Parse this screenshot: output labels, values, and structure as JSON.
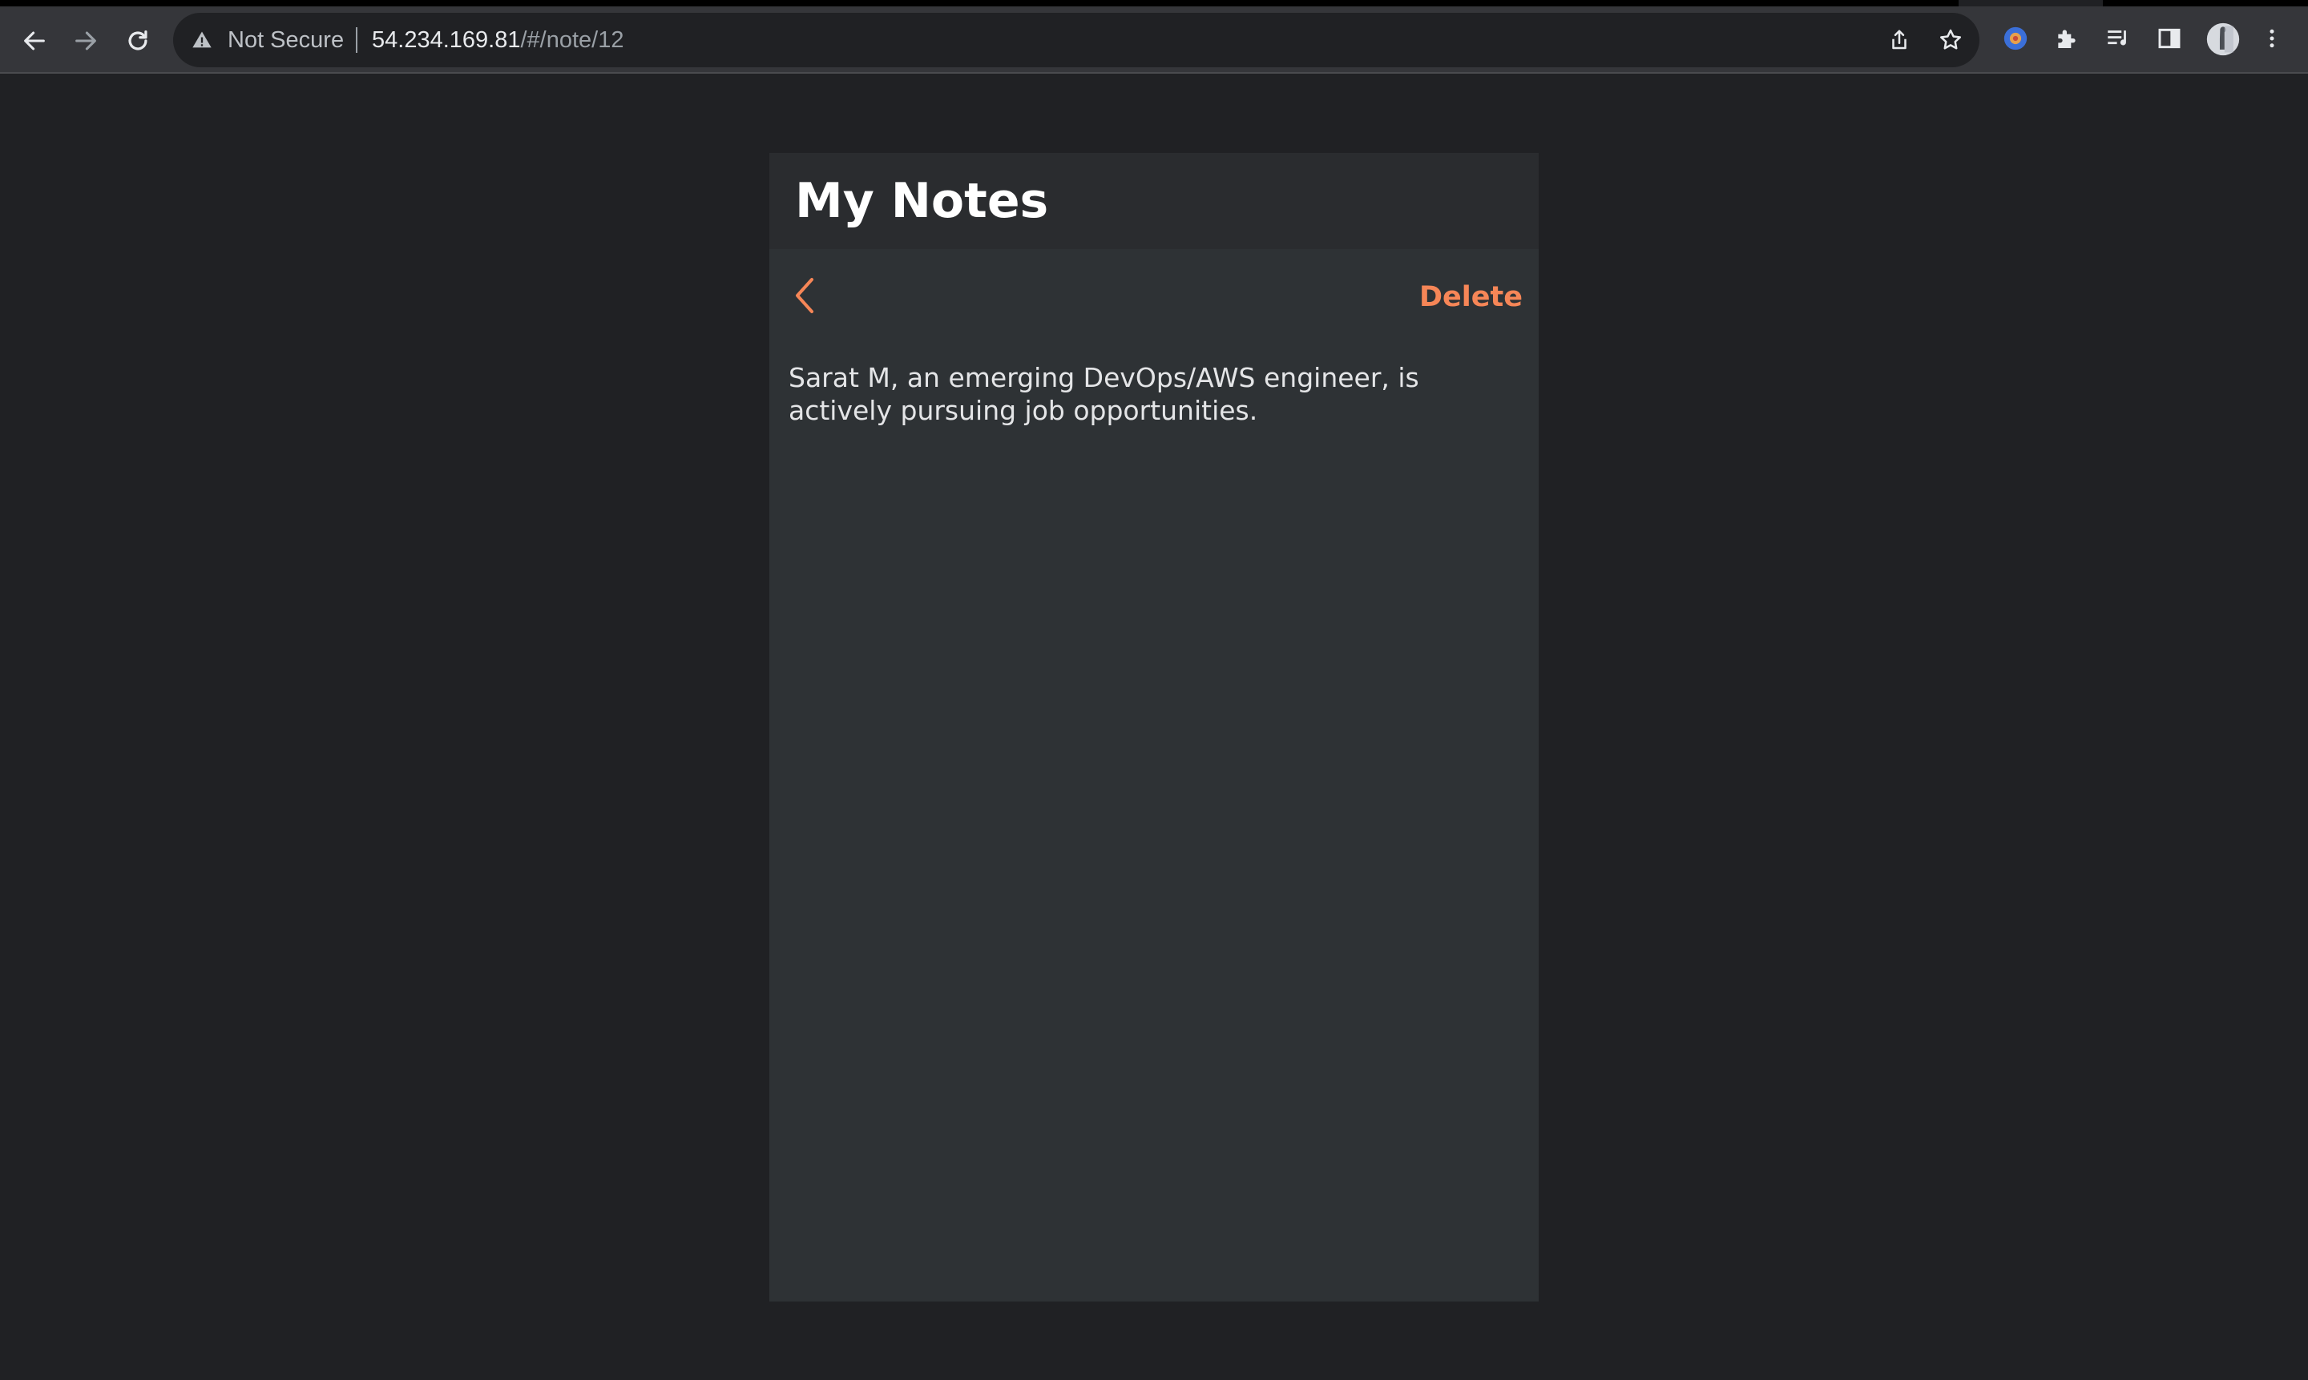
{
  "browser": {
    "security_label": "Not Secure",
    "url_host": "54.234.169.81",
    "url_path": "/#/note/12",
    "icons": {
      "back": "arrow-left-icon",
      "forward": "arrow-right-icon",
      "reload": "reload-icon",
      "warning": "warning-triangle-icon",
      "share": "share-icon",
      "bookmark": "star-icon",
      "extension_colored": "extension-badge-icon",
      "extensions": "puzzle-icon",
      "media": "media-queue-icon",
      "side_panel": "side-panel-icon",
      "profile": "avatar",
      "menu": "kebab-menu-icon"
    }
  },
  "app": {
    "title": "My Notes",
    "back_icon": "chevron-left-icon",
    "delete_label": "Delete",
    "note_text": "Sarat M, an emerging DevOps/AWS engineer, is actively pursuing job opportunities.",
    "colors": {
      "accent": "#f68657",
      "header_bg": "#2a2c2f",
      "body_bg": "#2e3235",
      "page_bg": "#202124"
    }
  }
}
